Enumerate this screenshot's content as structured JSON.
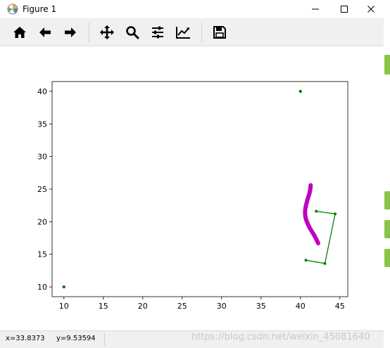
{
  "window": {
    "title": "Figure 1"
  },
  "toolbar": {
    "buttons": [
      {
        "name": "home",
        "icon": "home-icon"
      },
      {
        "name": "back",
        "icon": "arrow-left-icon"
      },
      {
        "name": "forward",
        "icon": "arrow-right-icon"
      },
      {
        "name": "pan",
        "icon": "move-icon"
      },
      {
        "name": "zoom",
        "icon": "search-icon"
      },
      {
        "name": "configure-subplots",
        "icon": "sliders-icon"
      },
      {
        "name": "edit-axis",
        "icon": "line-chart-icon"
      },
      {
        "name": "save",
        "icon": "floppy-disk-icon"
      }
    ]
  },
  "status": {
    "x": "x=33.8373",
    "y": "y=9.53594"
  },
  "watermark": "https://blog.csdn.net/weixin_45081640",
  "chart_data": {
    "type": "scatter",
    "xlim": [
      8.5,
      46.0
    ],
    "ylim": [
      8.5,
      41.5
    ],
    "xticks": [
      10,
      15,
      20,
      25,
      30,
      35,
      40,
      45
    ],
    "yticks": [
      10,
      15,
      20,
      25,
      30,
      35,
      40
    ],
    "grid": false,
    "colors": {
      "green": "#008000",
      "magenta": "#bf00bf"
    },
    "points": [
      {
        "x": 10,
        "y": 10
      },
      {
        "x": 40,
        "y": 40
      }
    ],
    "polyline": [
      {
        "x": 42.0,
        "y": 21.6
      },
      {
        "x": 44.4,
        "y": 21.2
      },
      {
        "x": 43.1,
        "y": 13.6
      },
      {
        "x": 40.7,
        "y": 14.1
      }
    ],
    "curve": [
      {
        "x": 41.3,
        "y": 25.6
      },
      {
        "x": 41.25,
        "y": 25.0
      },
      {
        "x": 41.15,
        "y": 24.4
      },
      {
        "x": 41.0,
        "y": 23.8
      },
      {
        "x": 40.85,
        "y": 23.2
      },
      {
        "x": 40.72,
        "y": 22.6
      },
      {
        "x": 40.62,
        "y": 22.0
      },
      {
        "x": 40.58,
        "y": 21.4
      },
      {
        "x": 40.62,
        "y": 20.8
      },
      {
        "x": 40.75,
        "y": 20.2
      },
      {
        "x": 40.95,
        "y": 19.6
      },
      {
        "x": 41.2,
        "y": 19.0
      },
      {
        "x": 41.5,
        "y": 18.4
      },
      {
        "x": 41.8,
        "y": 17.8
      },
      {
        "x": 42.05,
        "y": 17.2
      },
      {
        "x": 42.25,
        "y": 16.7
      }
    ]
  }
}
